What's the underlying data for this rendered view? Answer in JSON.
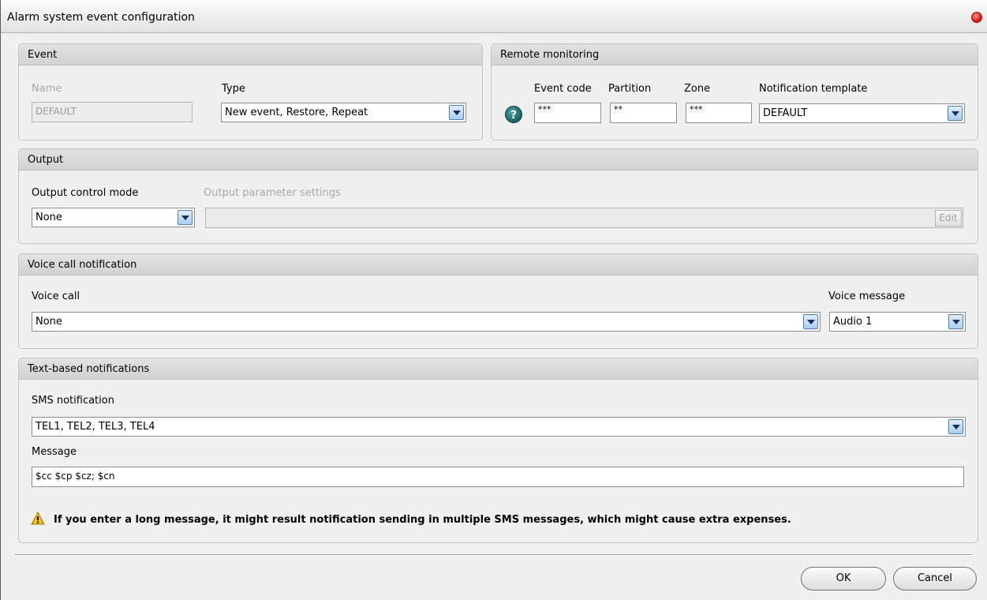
{
  "window": {
    "title": "Alarm system event configuration"
  },
  "event": {
    "header": "Event",
    "name_label": "Name",
    "name_value": "DEFAULT",
    "type_label": "Type",
    "type_value": "New event, Restore, Repeat"
  },
  "remote": {
    "header": "Remote monitoring",
    "event_code_label": "Event code",
    "event_code_value": "***",
    "partition_label": "Partition",
    "partition_value": "**",
    "zone_label": "Zone",
    "zone_value": "***",
    "template_label": "Notification template",
    "template_value": "DEFAULT",
    "help_glyph": "?"
  },
  "output": {
    "header": "Output",
    "mode_label": "Output control mode",
    "mode_value": "None",
    "params_label": "Output parameter settings",
    "params_value": "",
    "edit_label": "Edit"
  },
  "voice": {
    "header": "Voice call notification",
    "call_label": "Voice call",
    "call_value": "None",
    "message_label": "Voice message",
    "message_value": "Audio 1"
  },
  "text": {
    "header": "Text-based notifications",
    "sms_label": "SMS notification",
    "sms_value": "TEL1, TEL2, TEL3, TEL4",
    "message_label": "Message",
    "message_value": "$cc $cp $cz; $cn",
    "warning": "If you enter a long message, it might result notification sending in multiple SMS messages, which might cause extra expenses."
  },
  "buttons": {
    "ok": "OK",
    "cancel": "Cancel"
  },
  "icons": {
    "close": "close-icon",
    "help": "help-icon",
    "dropdown": "chevron-down-icon",
    "warning": "warning-icon"
  },
  "colors": {
    "close_red": "#e02020",
    "help_teal": "#1e6a6e",
    "warning_yellow": "#f2c200",
    "arrow_blue": "#4b7fb5"
  }
}
